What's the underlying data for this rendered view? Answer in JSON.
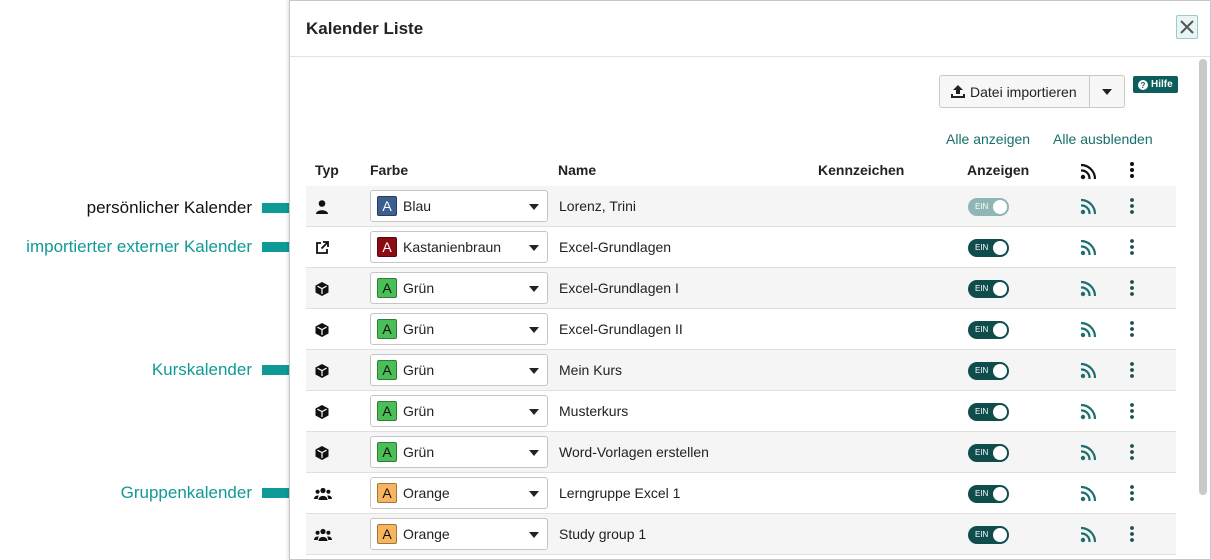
{
  "annotations": {
    "personal": "persönlicher Kalender",
    "imported": "importierter externer  Kalender",
    "course": "Kurskalender",
    "group": "Gruppenkalender"
  },
  "dialog": {
    "title": "Kalender Liste",
    "import_button": "Datei importieren",
    "help": "Hilfe",
    "show_all": "Alle anzeigen",
    "hide_all": "Alle ausblenden"
  },
  "table": {
    "headers": {
      "type": "Typ",
      "color": "Farbe",
      "name": "Name",
      "tag": "Kennzeichen",
      "show": "Anzeigen"
    },
    "toggle_label": "EIN",
    "swatch_letter": "A",
    "rows": [
      {
        "type": "personal-icon",
        "color": "Blau",
        "swatch_bg": "#3d5f8f",
        "swatch_fg": "#ffffff",
        "name": "Lorenz, Trini",
        "toggle": "EIN"
      },
      {
        "type": "external-link-icon",
        "color": "Kastanienbraun",
        "swatch_bg": "#8b0a14",
        "swatch_fg": "#ffffff",
        "name": "Excel-Grundlagen",
        "toggle": "EIN"
      },
      {
        "type": "course-cube-icon",
        "color": "Grün",
        "swatch_bg": "#4bbf57",
        "swatch_fg": "#111111",
        "name": "Excel-Grundlagen I",
        "toggle": "EIN"
      },
      {
        "type": "course-cube-icon",
        "color": "Grün",
        "swatch_bg": "#4bbf57",
        "swatch_fg": "#111111",
        "name": "Excel-Grundlagen II",
        "toggle": "EIN"
      },
      {
        "type": "course-cube-icon",
        "color": "Grün",
        "swatch_bg": "#4bbf57",
        "swatch_fg": "#111111",
        "name": "Mein Kurs",
        "toggle": "EIN"
      },
      {
        "type": "course-cube-icon",
        "color": "Grün",
        "swatch_bg": "#4bbf57",
        "swatch_fg": "#111111",
        "name": "Musterkurs",
        "toggle": "EIN"
      },
      {
        "type": "course-cube-icon",
        "color": "Grün",
        "swatch_bg": "#4bbf57",
        "swatch_fg": "#111111",
        "name": "Word-Vorlagen erstellen",
        "toggle": "EIN"
      },
      {
        "type": "group-icon",
        "color": "Orange",
        "swatch_bg": "#f6b55e",
        "swatch_fg": "#111111",
        "name": "Lerngruppe Excel 1",
        "toggle": "EIN"
      },
      {
        "type": "group-icon",
        "color": "Orange",
        "swatch_bg": "#f6b55e",
        "swatch_fg": "#111111",
        "name": "Study group 1",
        "toggle": "EIN"
      }
    ]
  },
  "colors": {
    "accent": "#0f9a98",
    "toggle_on": "#0f4d4c",
    "link": "#176e6c"
  }
}
